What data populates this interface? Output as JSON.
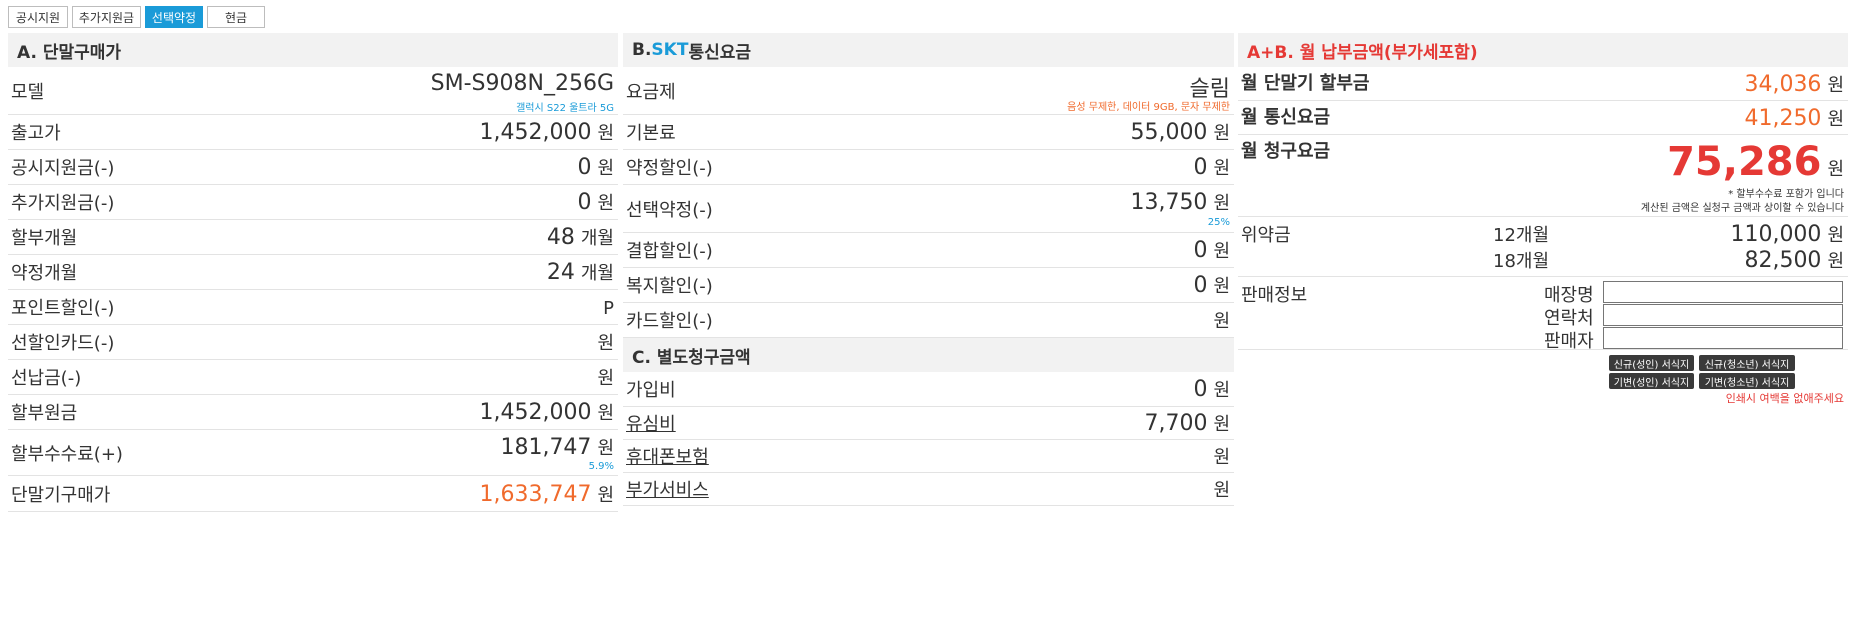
{
  "tabs": [
    {
      "label": "공시지원"
    },
    {
      "label": "추가지원금"
    },
    {
      "label": "선택약정",
      "active": true
    },
    {
      "label": "현금"
    }
  ],
  "section_a": {
    "title": "A. 단말구매가",
    "model_label": "모델",
    "model_value": "SM-S908N_256G",
    "model_sub": "갤럭시 S22 울트라 5G",
    "rows": [
      {
        "label": "출고가",
        "value": "1,452,000",
        "unit": "원"
      },
      {
        "label": "공시지원금(-)",
        "value": "0",
        "unit": "원"
      },
      {
        "label": "추가지원금(-)",
        "value": "0",
        "unit": "원"
      },
      {
        "label": "할부개월",
        "value": "48",
        "unit": "개월"
      },
      {
        "label": "약정개월",
        "value": "24",
        "unit": "개월"
      },
      {
        "label": "포인트할인(-)",
        "value": "",
        "unit": "P"
      },
      {
        "label": "선할인카드(-)",
        "value": "",
        "unit": "원"
      },
      {
        "label": "선납금(-)",
        "value": "",
        "unit": "원"
      },
      {
        "label": "할부원금",
        "value": "1,452,000",
        "unit": "원"
      },
      {
        "label": "할부수수료(+)",
        "value": "181,747",
        "unit": "원",
        "sub": "5.9%"
      },
      {
        "label": "단말기구매가",
        "value": "1,633,747",
        "unit": "원",
        "highlight": true
      }
    ]
  },
  "section_b": {
    "title_prefix": "B. ",
    "title_brand": "SKT",
    "title_rest": "통신요금",
    "plan_label": "요금제",
    "plan_value": "슬림",
    "plan_sub": "음성 무제한, 데이터 9GB, 문자 무제한",
    "rows": [
      {
        "label": "기본료",
        "value": "55,000",
        "unit": "원"
      },
      {
        "label": "약정할인(-)",
        "value": "0",
        "unit": "원"
      },
      {
        "label": "선택약정(-)",
        "value": "13,750",
        "unit": "원",
        "sub": "25%"
      },
      {
        "label": "결합할인(-)",
        "value": "0",
        "unit": "원"
      },
      {
        "label": "복지할인(-)",
        "value": "0",
        "unit": "원"
      },
      {
        "label": "카드할인(-)",
        "value": "",
        "unit": "원"
      }
    ]
  },
  "section_c": {
    "title": "C. 별도청구금액",
    "rows": [
      {
        "label": "가입비",
        "value": "0",
        "unit": "원",
        "link": false
      },
      {
        "label": "유심비",
        "value": "7,700",
        "unit": "원",
        "link": true
      },
      {
        "label": "휴대폰보험",
        "value": "",
        "unit": "원",
        "link": true
      },
      {
        "label": "부가서비스",
        "value": "",
        "unit": "원",
        "link": true
      }
    ]
  },
  "section_total": {
    "title": "A+B. 월 납부금액(부가세포함)",
    "installment_label": "월 단말기 할부금",
    "installment_value": "34,036",
    "telecom_label": "월 통신요금",
    "telecom_value": "41,250",
    "bill_label": "월 청구요금",
    "bill_value": "75,286",
    "unit": "원",
    "note1": "* 할부수수료 포함가 입니다",
    "note2": "계산된 금액은 실청구 금액과 상이할 수 있습니다",
    "penalty_label": "위약금",
    "penalty": [
      {
        "period": "12개월",
        "value": "110,000",
        "unit": "원"
      },
      {
        "period": "18개월",
        "value": "82,500",
        "unit": "원"
      }
    ],
    "sales_label": "판매정보",
    "store_label": "매장명",
    "contact_label": "연락처",
    "seller_label": "판매자",
    "buttons": [
      "신규(성인) 서식지",
      "신규(청소년) 서식지",
      "기변(성인) 서식지",
      "기변(청소년) 서식지"
    ],
    "print_note": "인쇄시 여백을 없애주세요"
  }
}
